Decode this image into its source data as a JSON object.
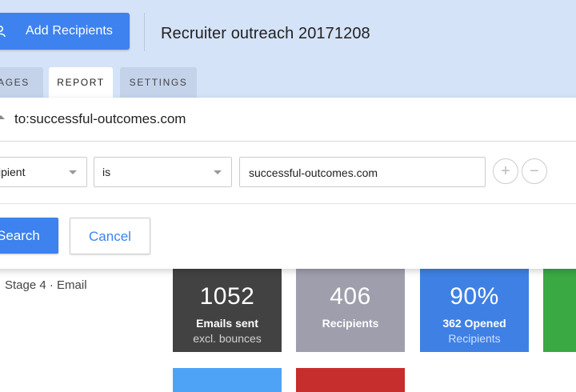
{
  "header": {
    "add_recipients_label": "Add Recipients",
    "add_recipients_icon": "person-add-icon",
    "campaign_title": "Recruiter outreach 20171208"
  },
  "tabs": [
    {
      "label": "STAGES",
      "visible_text": "AGES",
      "active": false
    },
    {
      "label": "REPORT",
      "active": true
    },
    {
      "label": "SETTINGS",
      "active": false
    }
  ],
  "search": {
    "query": "to:successful-outcomes.com",
    "filter": {
      "field": "Recipient",
      "field_visible": "cipient",
      "operator": "is",
      "value": "successful-outcomes.com"
    },
    "add_icon": "plus-icon",
    "remove_icon": "minus-icon",
    "search_label": "Search",
    "search_visible": "Search",
    "cancel_label": "Cancel"
  },
  "stage_label": "Stage 4 · Email",
  "stats": [
    {
      "value": "1052",
      "title": "Emails sent",
      "sub": "excl. bounces",
      "color": "#424242"
    },
    {
      "value": "406",
      "title": "Recipients",
      "sub": "",
      "color": "#9e9ead"
    },
    {
      "value": "90%",
      "title": "362 Opened",
      "sub": "Recipients",
      "color": "#3f80e4"
    }
  ],
  "colors": {
    "accent": "#3d82ee",
    "header_bg": "#d5e3f8",
    "card_green": "#3aa843",
    "card_blue": "#4fa3f7",
    "card_red": "#c62d2d"
  }
}
